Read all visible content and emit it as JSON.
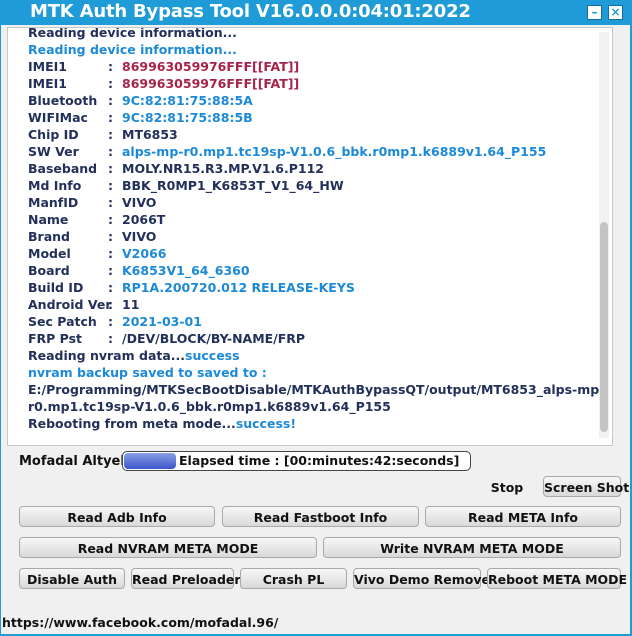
{
  "window": {
    "title": "MTK Auth Bypass Tool V16.0.0.0:04:01:2022"
  },
  "log": {
    "partial_top": "Reading device information...",
    "heading": "Reading device information...",
    "rows": [
      {
        "label": "IMEI1",
        "sep": ":",
        "value": "869963059976FFF[[FAT]]",
        "color": "#a8234a"
      },
      {
        "label": "IMEI1",
        "sep": ":",
        "value": "869963059976FFF[[FAT]]",
        "color": "#a8234a"
      },
      {
        "label": "Bluetooth",
        "sep": ":",
        "value": "9C:82:81:75:88:5A",
        "color": "#1c8ad8"
      },
      {
        "label": "WIFIMac",
        "sep": ":",
        "value": "9C:82:81:75:88:5B",
        "color": "#1c8ad8"
      },
      {
        "label": "Chip ID",
        "sep": ":",
        "value": "MT6853",
        "color": "#22305a"
      },
      {
        "label": "SW Ver",
        "sep": ":",
        "value": "alps-mp-r0.mp1.tc19sp-V1.0.6_bbk.r0mp1.k6889v1.64_P155",
        "color": "#1c8ad8"
      },
      {
        "label": "Baseband",
        "sep": ":",
        "value": "MOLY.NR15.R3.MP.V1.6.P112",
        "color": "#22305a"
      },
      {
        "label": "Md Info",
        "sep": ":",
        "value": "BBK_R0MP1_K6853T_V1_64_HW",
        "color": "#22305a"
      },
      {
        "label": "ManfID",
        "sep": ":",
        "value": "VIVO",
        "color": "#22305a"
      },
      {
        "label": "Name",
        "sep": ":",
        "value": "2066T",
        "color": "#22305a"
      },
      {
        "label": "Brand",
        "sep": ":",
        "value": "VIVO",
        "color": "#22305a"
      },
      {
        "label": "Model",
        "sep": ":",
        "value": "V2066",
        "color": "#1c8ad8"
      },
      {
        "label": "Board",
        "sep": ":",
        "value": "K6853V1_64_6360",
        "color": "#1c8ad8"
      },
      {
        "label": "Build ID",
        "sep": ":",
        "value": "RP1A.200720.012 RELEASE-KEYS",
        "color": "#1c8ad8"
      },
      {
        "label": "Android Ver",
        "sep": ":",
        "value": "11",
        "color": "#22305a"
      },
      {
        "label": "Sec Patch",
        "sep": ":",
        "value": "2021-03-01",
        "color": "#1c8ad8"
      },
      {
        "label": "FRP Pst",
        "sep": ":",
        "value": "/DEV/BLOCK/BY-NAME/FRP",
        "color": "#22305a"
      }
    ],
    "nvram_prefix": "Reading nvram data...",
    "nvram_status": "success",
    "backup_line": "nvram backup saved to saved to :",
    "path_line1": "E:/Programming/MTKSecBootDisable/MTKAuthBypassQT/output/MT6853_alps-mp-",
    "path_line2": "r0.mp1.tc19sp-V1.0.6_bbk.r0mp1.k6889v1.64_P155",
    "reboot_prefix": "Rebooting from meta mode...",
    "reboot_status": "success!"
  },
  "status": {
    "author": "Mofadal Altyeb",
    "elapsed": "Elapsed time : [00:minutes:42:seconds]",
    "progress_fraction": 0.15
  },
  "buttons": {
    "stop": "Stop",
    "screenshot": "Screen Shot",
    "read_adb": "Read Adb Info",
    "read_fastboot": "Read Fastboot Info",
    "read_meta": "Read META Info",
    "read_nvram": "Read NVRAM META MODE",
    "write_nvram": "Write NVRAM META MODE",
    "disable_auth": "Disable Auth",
    "read_preloader": "Read Preloader",
    "crash_pl": "Crash PL",
    "vivo_demo": "Vivo Demo Remove",
    "reboot_meta": "Reboot META MODE"
  },
  "footer": {
    "link": "https://www.facebook.com/mofadal.96/"
  }
}
